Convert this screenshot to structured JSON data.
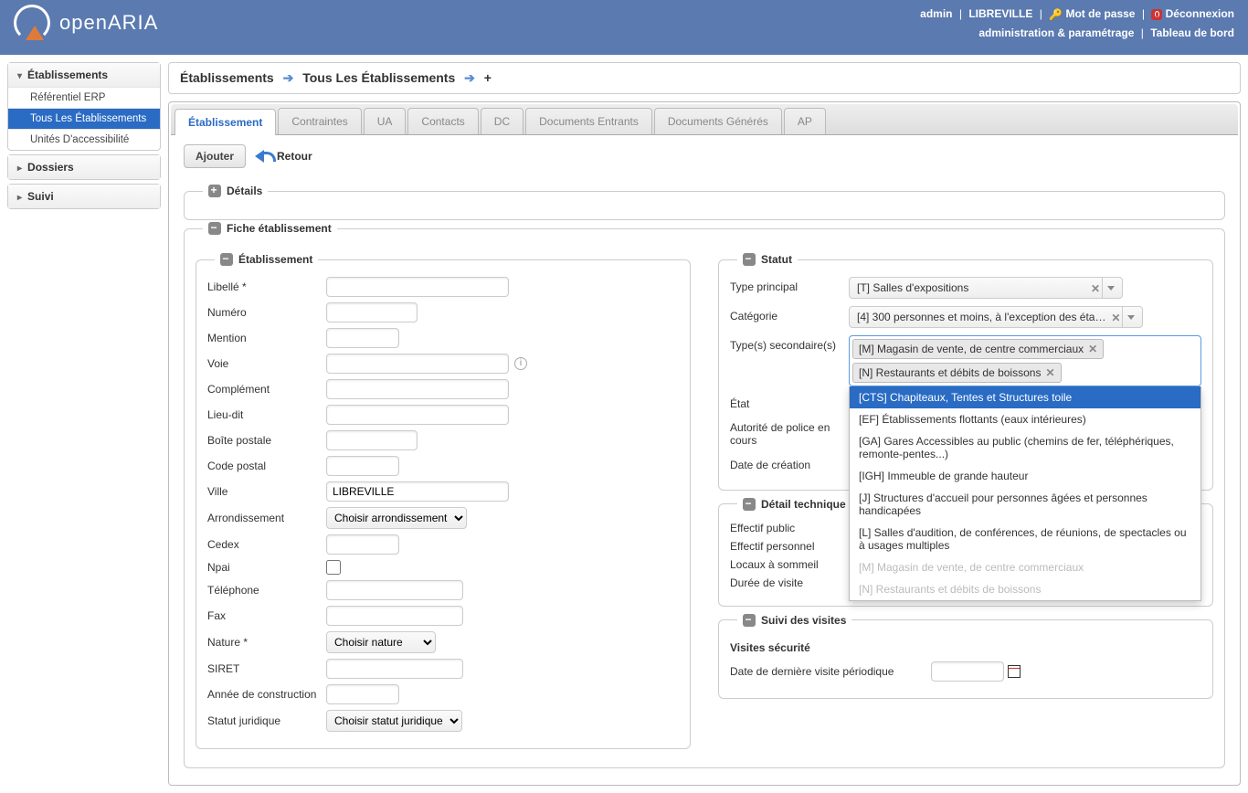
{
  "brand": "openARIA",
  "header": {
    "user": "admin",
    "city": "LIBREVILLE",
    "password": "Mot de passe",
    "logout": "Déconnexion",
    "admin": "administration & paramétrage",
    "dashboard": "Tableau de bord"
  },
  "sidebar": {
    "s1": {
      "title": "Établissements",
      "items": [
        "Référentiel ERP",
        "Tous Les Établissements",
        "Unités D'accessibilité"
      ],
      "active": 1
    },
    "s2": {
      "title": "Dossiers"
    },
    "s3": {
      "title": "Suivi"
    }
  },
  "breadcrumb": {
    "a": "Établissements",
    "b": "Tous Les Établissements",
    "c": "+"
  },
  "tabs": [
    "Établissement",
    "Contraintes",
    "UA",
    "Contacts",
    "DC",
    "Documents Entrants",
    "Documents Générés",
    "AP"
  ],
  "toolbar": {
    "add": "Ajouter",
    "back": "Retour"
  },
  "fs": {
    "details": "Détails",
    "fiche": "Fiche établissement",
    "etab": "Établissement",
    "statut": "Statut",
    "detail_tech": "Détail technique",
    "suivi": "Suivi des visites"
  },
  "form": {
    "libelle": "Libellé *",
    "numero": "Numéro",
    "mention": "Mention",
    "voie": "Voie",
    "complement": "Complément",
    "lieudit": "Lieu-dit",
    "bp": "Boîte postale",
    "cp": "Code postal",
    "ville": "Ville",
    "ville_val": "LIBREVILLE",
    "arrond": "Arrondissement",
    "arrond_opt": "Choisir arrondissement",
    "cedex": "Cedex",
    "npai": "Npai",
    "tel": "Téléphone",
    "fax": "Fax",
    "nature": "Nature *",
    "nature_opt": "Choisir nature",
    "siret": "SIRET",
    "annee": "Année de construction",
    "statutj": "Statut juridique",
    "statutj_opt": "Choisir statut juridique"
  },
  "statut": {
    "type_principal_lbl": "Type principal",
    "type_principal_val": "[T] Salles d'expositions",
    "categorie_lbl": "Catégorie",
    "categorie_val": "[4] 300 personnes et moins, à l'exception des éta…",
    "types_sec_lbl": "Type(s) secondaire(s)",
    "tags": [
      "[M] Magasin de vente, de centre commerciaux",
      "[N] Restaurants et débits de boissons"
    ],
    "etat_lbl": "État",
    "autorite_lbl": "Autorité de police en cours",
    "date_creation_lbl": "Date de création"
  },
  "dropdown": [
    {
      "t": "[CTS] Chapiteaux, Tentes et Structures toile",
      "hl": true
    },
    {
      "t": "[EF] Établissements flottants (eaux intérieures)"
    },
    {
      "t": "[GA] Gares Accessibles au public (chemins de fer, téléphériques, remonte-pentes...)"
    },
    {
      "t": "[IGH] Immeuble de grande hauteur"
    },
    {
      "t": "[J] Structures d'accueil pour personnes âgées et personnes handicapées"
    },
    {
      "t": "[L] Salles d'audition, de conférences, de réunions, de spectacles ou à usages multiples"
    },
    {
      "t": "[M] Magasin de vente, de centre commerciaux",
      "dis": true
    },
    {
      "t": "[N] Restaurants et débits de boissons",
      "dis": true
    }
  ],
  "detail_tech": {
    "eff_public": "Effectif public",
    "eff_pers": "Effectif personnel",
    "locaux": "Locaux à sommeil",
    "duree": "Durée de visite"
  },
  "suivi": {
    "visites_sec": "Visites sécurité",
    "date_derniere": "Date de dernière visite périodique"
  }
}
